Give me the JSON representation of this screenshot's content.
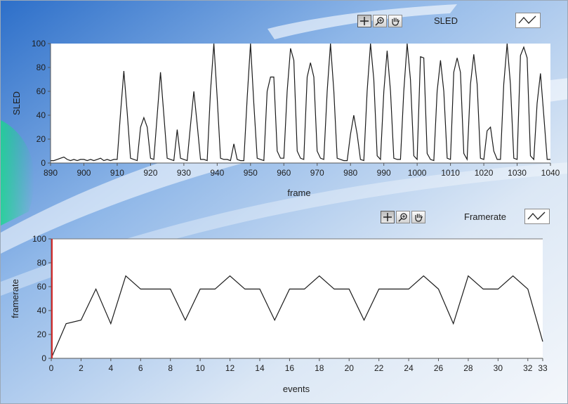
{
  "theme": {
    "plot_bg": "#ffffff",
    "trace_color": "#1a1a1a",
    "cursor_color": "#d42a2a",
    "axis_color": "#555555"
  },
  "toolbar_icons": [
    "cursor-crosshair-icon",
    "zoom-icon",
    "pan-hand-icon"
  ],
  "chart_data": [
    {
      "type": "line",
      "legend": "SLED",
      "xlabel": "frame",
      "ylabel": "SLED",
      "xlim": [
        890,
        1040
      ],
      "ylim": [
        0,
        100
      ],
      "xticks": [
        890,
        900,
        910,
        920,
        930,
        940,
        950,
        960,
        970,
        980,
        990,
        1000,
        1010,
        1020,
        1030,
        1040
      ],
      "yticks": [
        0,
        20,
        40,
        60,
        80,
        100
      ],
      "grid": false,
      "series": [
        {
          "x": [
            890,
            891,
            892,
            893,
            894,
            895,
            896,
            897,
            898,
            899,
            900,
            901,
            902,
            903,
            904,
            905,
            906,
            907,
            908,
            909,
            910,
            911,
            912,
            913,
            914,
            915,
            916,
            917,
            918,
            919,
            920,
            921,
            922,
            923,
            924,
            925,
            926,
            927,
            928,
            929,
            930,
            931,
            932,
            933,
            934,
            935,
            936,
            937,
            938,
            939,
            940,
            941,
            942,
            943,
            944,
            945,
            946,
            947,
            948,
            949,
            950,
            951,
            952,
            953,
            954,
            955,
            956,
            957,
            958,
            959,
            960,
            961,
            962,
            963,
            964,
            965,
            966,
            967,
            968,
            969,
            970,
            971,
            972,
            973,
            974,
            975,
            976,
            977,
            978,
            979,
            980,
            981,
            982,
            983,
            984,
            985,
            986,
            987,
            988,
            989,
            990,
            991,
            992,
            993,
            994,
            995,
            996,
            997,
            998,
            999,
            1000,
            1001,
            1002,
            1003,
            1004,
            1005,
            1006,
            1007,
            1008,
            1009,
            1010,
            1011,
            1012,
            1013,
            1014,
            1015,
            1016,
            1017,
            1018,
            1019,
            1020,
            1021,
            1022,
            1023,
            1024,
            1025,
            1026,
            1027,
            1028,
            1029,
            1030,
            1031,
            1032,
            1033,
            1034,
            1035,
            1036,
            1037,
            1038,
            1039,
            1040
          ],
          "y": [
            2,
            2,
            3,
            4,
            5,
            3,
            2,
            3,
            2,
            3,
            3,
            2,
            3,
            2,
            3,
            4,
            2,
            3,
            2,
            3,
            3,
            42,
            77,
            42,
            4,
            3,
            2,
            30,
            38,
            30,
            4,
            3,
            40,
            76,
            40,
            4,
            3,
            2,
            28,
            4,
            3,
            2,
            32,
            60,
            32,
            3,
            3,
            2,
            60,
            100,
            55,
            4,
            3,
            3,
            2,
            16,
            3,
            2,
            2,
            55,
            100,
            50,
            4,
            3,
            2,
            60,
            72,
            72,
            10,
            4,
            4,
            60,
            96,
            86,
            10,
            4,
            3,
            72,
            84,
            72,
            10,
            4,
            3,
            60,
            100,
            60,
            4,
            3,
            2,
            2,
            24,
            40,
            24,
            3,
            2,
            60,
            100,
            70,
            6,
            3,
            60,
            94,
            60,
            4,
            3,
            3,
            60,
            100,
            70,
            6,
            3,
            89,
            88,
            8,
            3,
            2,
            60,
            86,
            60,
            4,
            3,
            76,
            88,
            76,
            8,
            3,
            66,
            91,
            66,
            4,
            3,
            27,
            30,
            10,
            3,
            3,
            66,
            100,
            66,
            4,
            3,
            90,
            97,
            88,
            6,
            3,
            50,
            75,
            40,
            3,
            3
          ]
        }
      ]
    },
    {
      "type": "line",
      "legend": "Framerate",
      "xlabel": "events",
      "ylabel": "framerate",
      "xlim": [
        0,
        33
      ],
      "ylim": [
        0,
        100
      ],
      "xticks": [
        0,
        2,
        4,
        6,
        8,
        10,
        12,
        14,
        16,
        18,
        20,
        22,
        24,
        26,
        28,
        30,
        32,
        33
      ],
      "yticks": [
        0,
        20,
        40,
        60,
        80,
        100
      ],
      "grid": false,
      "cursor_x": 0,
      "series": [
        {
          "x": [
            0,
            1,
            2,
            3,
            4,
            5,
            6,
            7,
            8,
            9,
            10,
            11,
            12,
            13,
            14,
            15,
            16,
            17,
            18,
            19,
            20,
            21,
            22,
            23,
            24,
            25,
            26,
            27,
            28,
            29,
            30,
            31,
            32,
            33
          ],
          "y": [
            0,
            29,
            32,
            58,
            29,
            69,
            58,
            58,
            58,
            32,
            58,
            58,
            69,
            58,
            58,
            32,
            58,
            58,
            69,
            58,
            58,
            32,
            58,
            58,
            58,
            69,
            58,
            29,
            69,
            58,
            58,
            69,
            58,
            14
          ]
        }
      ]
    }
  ]
}
